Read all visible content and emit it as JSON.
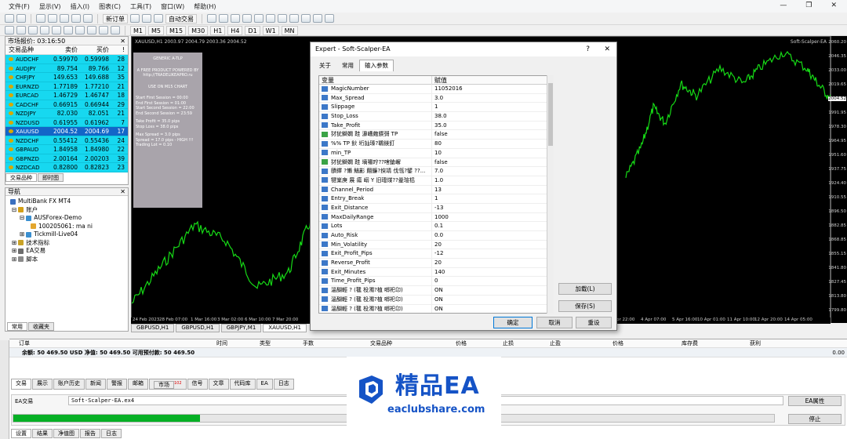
{
  "menu": [
    "文件(F)",
    "显示(V)",
    "插入(I)",
    "图表(C)",
    "工具(T)",
    "窗口(W)",
    "帮助(H)"
  ],
  "toolbar": {
    "new_order": "新订单",
    "auto_trade": "自动交易",
    "timeframes": [
      "M1",
      "M5",
      "M15",
      "M30",
      "H1",
      "H4",
      "D1",
      "W1",
      "MN"
    ]
  },
  "market_watch": {
    "title": "市场报价: 03:16:50",
    "cols": [
      "交易品种",
      "卖价",
      "买价",
      "!"
    ],
    "rows": [
      [
        "AUDCHF",
        "0.59970",
        "0.59998",
        "28"
      ],
      [
        "AUDJPY",
        "89.754",
        "89.766",
        "12"
      ],
      [
        "CHFJPY",
        "149.653",
        "149.688",
        "35"
      ],
      [
        "EURNZD",
        "1.77189",
        "1.77210",
        "21"
      ],
      [
        "EURCAD",
        "1.46729",
        "1.46747",
        "18"
      ],
      [
        "CADCHF",
        "0.66915",
        "0.66944",
        "29"
      ],
      [
        "NZDJPY",
        "82.030",
        "82.051",
        "21"
      ],
      [
        "NZDUSD",
        "0.61955",
        "0.61962",
        "7"
      ],
      [
        "XAUUSD",
        "2004.52",
        "2004.69",
        "17"
      ],
      [
        "NZDCHF",
        "0.55412",
        "0.55436",
        "24"
      ],
      [
        "GBPAUD",
        "1.84958",
        "1.84980",
        "22"
      ],
      [
        "GBPNZD",
        "2.00164",
        "2.00203",
        "39"
      ],
      [
        "NZDCAD",
        "0.82800",
        "0.82823",
        "23"
      ]
    ],
    "tabs": [
      "交易品种",
      "即时图"
    ]
  },
  "navigator": {
    "title": "导航",
    "items": [
      "MultiBank FX MT4",
      "账户",
      "AUSForex-Demo",
      "100205061: ma ni",
      "Tickmill-Live04",
      "技术指标",
      "EA交易",
      "脚本"
    ],
    "tabs": [
      "常用",
      "收藏夹"
    ]
  },
  "chart": {
    "title": "XAUUSD,H1  2003.97 2004.79 2003.36 2004.52",
    "ea_label": "Soft-Scalper-EA",
    "info": [
      "GENERIC A-TLP",
      "A FREE PRODUCT POWERED BY",
      "http://TRADELIKEAPRO.ru",
      "USE ON M15 CHART",
      "Start First Session = 00:00",
      "End First Session = 01:00",
      "Start Second Session = 22:00",
      "End Second Session = 23:59",
      "Take Profit = 35.0 pips",
      "Stop Loss = 38.0 pips",
      "Max Spread = 3.0 pips",
      "Spread = 17.0 pips - HIGH !!!",
      "Trading Lot = 0.10"
    ],
    "price_labels": [
      "2060.20",
      "2046.35",
      "2033.00",
      "2019.65",
      "2004.52",
      "1991.95",
      "1978.30",
      "1964.95",
      "1951.60",
      "1937.75",
      "1924.40",
      "1910.55",
      "1896.50",
      "1882.85",
      "1868.85",
      "1855.15",
      "1841.80",
      "1827.45",
      "1813.80",
      "1799.80"
    ],
    "time_labels": [
      "24 Feb 2023",
      "28 Feb 07:00",
      "1 Mar 16:00",
      "3 Mar 02:00",
      "6 Mar 10:00",
      "7 Mar 20:00",
      "2 Apr 22:00",
      "4 Apr 07:00",
      "5 Apr 16:00",
      "10 Apr 01:00",
      "11 Apr 10:00",
      "12 Apr 20:00",
      "14 Apr 05:00"
    ],
    "tabs": [
      "GBPUSD,H1",
      "GBPUSD,H1",
      "GBPJPY,M1",
      "XAUUSD,H1"
    ]
  },
  "dialog": {
    "title": "Expert - Soft-Scalper-EA",
    "help": "?",
    "close": "✕",
    "tabs": [
      "关于",
      "常用",
      "输入参数"
    ],
    "col_var": "变量",
    "col_val": "赋值",
    "params": [
      [
        "MagicNumber",
        "11052016"
      ],
      [
        "Max_Spread",
        "3.0"
      ],
      [
        "Slippage",
        "1"
      ],
      [
        "Stop_Loss",
        "38.0"
      ],
      [
        "Take_Profit",
        "35.0"
      ],
      [
        "犲犹鰤嫻 跬 濞嶆皰鍥彁 TP",
        "false"
      ],
      [
        "%% TP 鈥 垳訕瑧?鶤鎂釘",
        "80"
      ],
      [
        "min_TP",
        "10"
      ],
      [
        "犲犹鰤嫻 跬 墑嘯咛??嗐鎗嶰",
        "false"
      ],
      [
        "賾鐸 ?懶     鱔彲 翸鐮?揬靖 伐瓴?鐾 ??...",
        "7.0"
      ],
      [
        "犍嶪庚   展 瘍 嵶 Y 旧璁煤??曐瑄梠",
        "1.0"
      ],
      [
        "Channel_Period",
        "13"
      ],
      [
        "Entry_Break",
        "1"
      ],
      [
        "Exit_Distance",
        "-13"
      ],
      [
        "MaxDailyRange",
        "1000"
      ],
      [
        "Lots",
        "0.1"
      ],
      [
        "Auto_Risk",
        "0.0"
      ],
      [
        "Min_Volatility",
        "20"
      ],
      [
        "Exit_Profit_Pips",
        "-12"
      ],
      [
        "Reverse_Profit",
        "20"
      ],
      [
        "Exit_Minutes",
        "140"
      ],
      [
        "Time_Profit_Pips",
        "0"
      ],
      [
        "溫醐輕 ? (毽 杸濁?植 啷祀卬)",
        "ON"
      ],
      [
        "溫醐輕 ? (毽 杸濁?植 啷祀卬)",
        "ON"
      ],
      [
        "溫醐輕 ? (毽 杸濁?植 啷祀卬)",
        "ON"
      ]
    ],
    "load": "加载(L)",
    "save": "保存(S)",
    "ok": "确定",
    "cancel": "取消",
    "reset": "重设"
  },
  "terminal": {
    "cols": [
      "订单",
      "时间",
      "类型",
      "手数",
      "交易品种",
      "价格",
      "止损",
      "止盈",
      "价格",
      "库存费",
      "获利"
    ],
    "balance": "余额: 50 469.50 USD  净值: 50 469.50  可用预付款: 50 469.50",
    "profit": "0.00",
    "tabs": [
      "交易",
      "展示",
      "账户历史",
      "新闻",
      "警报",
      "邮箱",
      "市场",
      "信号",
      "文章",
      "代码库",
      "EA",
      "日志"
    ],
    "market_badge": "102",
    "ea_select": "EA交易",
    "ea_file": "Soft-Scalper-EA.ex4",
    "ea_props": "EA属性",
    "stop": "停止",
    "progress": 0.245,
    "bottom_tabs": [
      "设置",
      "结果",
      "净值图",
      "报告",
      "日志"
    ]
  },
  "watermark": {
    "title": "精品EA",
    "url": "eaclubshare.com"
  }
}
